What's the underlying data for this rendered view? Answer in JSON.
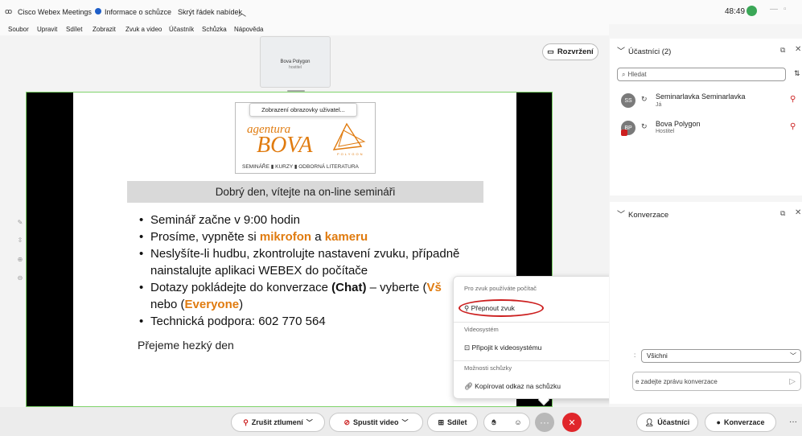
{
  "titlebar": {
    "app_name": "Cisco Webex Meetings",
    "info_label": "Informace o schůzce",
    "hide_menu_label": "Skrýt řádek nabídek",
    "timer": "48:49"
  },
  "menu": [
    "Soubor",
    "Upravit",
    "Sdílet",
    "Zobrazit",
    "Zvuk a video",
    "Účastník",
    "Schůzka",
    "Nápověda"
  ],
  "layout_button": "Rozvržení",
  "thumbnail": {
    "name": "Bova Polygon",
    "role": "hostitel"
  },
  "share_tooltip": "Zobrazení obrazovky uživatel...",
  "slide": {
    "logo_line1": "agentura",
    "logo_line2": "BOVA",
    "logo_sub": "POLYGON",
    "logo_tagline": "SEMINÁŘE ▮ KURZY ▮ ODBORNÁ LITERATURA",
    "heading": "Dobrý den, vítejte na on-line semináři",
    "b1": "Seminář začne v 9:00 hodin",
    "b2_a": "Prosíme, vypněte si ",
    "b2_b": "mikrofon",
    "b2_c": " a ",
    "b2_d": "kameru",
    "b3_a": "Neslyšíte-li hudbu, zkontrolujte nastavení zvuku, případně",
    "b3_b": "nainstalujte aplikaci WEBEX do počítače",
    "b4_a": "Dotazy pokládejte do konverzace ",
    "b4_b": "(Chat)",
    "b4_c": " – vyberte (",
    "b4_d": "Vš",
    "b4_e": "nebo (",
    "b4_f": "Everyone",
    "b4_g": ")",
    "b5": "Technická podpora: 602 770 564",
    "footer": "Přejeme hezký den"
  },
  "participants": {
    "title": "Účastníci (2)",
    "search_placeholder": "Hledat",
    "list": [
      {
        "initials": "SS",
        "name": "Seminarlavka Seminarlavka",
        "role": "Já"
      },
      {
        "initials": "BP",
        "name": "Bova Polygon",
        "role": "Hostitel"
      }
    ]
  },
  "chat": {
    "title": "Konverzace",
    "recipient": "Všichni",
    "input_placeholder": "e zadejte zprávu konverzace"
  },
  "popup": {
    "sec1": "Pro zvuk používáte počítač",
    "switch_audio": "Přepnout zvuk",
    "sec2": "Videosystém",
    "connect_video": "Připojit k videosystému",
    "sec3": "Možnosti schůzky",
    "copy_link": "Kopírovat odkaz na schůzku"
  },
  "bottombar": {
    "unmute": "Zrušit ztlumení",
    "start_video": "Spustit video",
    "share": "Sdílet",
    "participants": "Účastníci",
    "chat": "Konverzace"
  },
  "colors": {
    "accent_orange": "#e07b0f",
    "end_red": "#e0262b",
    "highlight_red": "#cc1f1f",
    "slide_border": "#7fd36b",
    "webex_green": "#3aa757"
  }
}
